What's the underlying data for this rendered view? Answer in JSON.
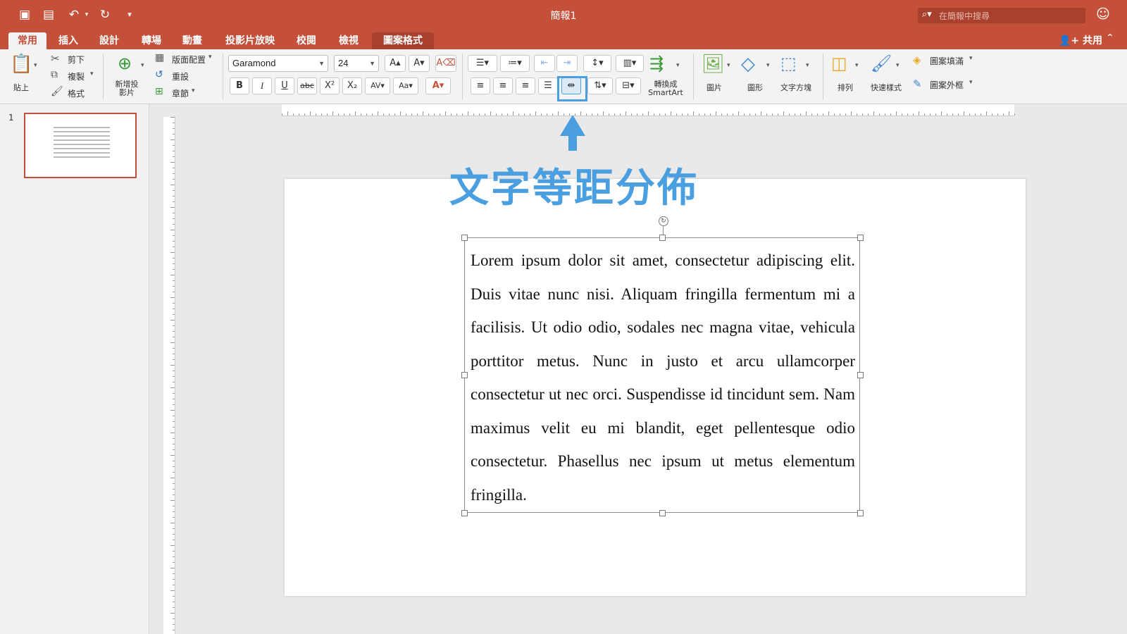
{
  "window": {
    "title": "簡報1",
    "search_placeholder": "在簡報中搜尋"
  },
  "tabs": [
    {
      "label": "常用",
      "active": true
    },
    {
      "label": "插入"
    },
    {
      "label": "設計"
    },
    {
      "label": "轉場"
    },
    {
      "label": "動畫"
    },
    {
      "label": "投影片放映"
    },
    {
      "label": "校閱"
    },
    {
      "label": "檢視"
    },
    {
      "label": "圖案格式",
      "contextual": true
    }
  ],
  "share_label": "共用",
  "ribbon": {
    "clipboard": {
      "paste": "貼上",
      "cut": "剪下",
      "copy": "複製",
      "format": "格式"
    },
    "slides": {
      "new_slide_line1": "新增投",
      "new_slide_line2": "影片",
      "layout": "版面配置",
      "reset": "重設",
      "section": "章節"
    },
    "font": {
      "name": "Garamond",
      "size": "24"
    },
    "convert_line1": "轉換成",
    "convert_line2": "SmartArt",
    "drawing": {
      "picture": "圖片",
      "shapes": "圖形",
      "textbox": "文字方塊",
      "arrange": "排列",
      "quick_styles": "快速樣式",
      "shape_fill": "圖案填滿",
      "shape_outline": "圖案外框"
    }
  },
  "slide_panel": {
    "slide_number": "1"
  },
  "slide": {
    "body_text": "Lorem ipsum dolor sit amet, consectetur adipiscing elit. Duis vitae nunc nisi. Aliquam fringilla fermentum mi a facilisis. Ut odio odio, sodales nec magna vitae, vehicula porttitor metus. Nunc in justo et arcu ullamcorper consectetur ut nec orci. Suspendisse id tincidunt sem. Nam maximus velit eu mi blandit, eget pellentesque odio consectetur. Phasellus nec ipsum ut metus elementum fringilla."
  },
  "annotation": "文字等距分佈",
  "colors": {
    "accent": "#c4503a",
    "annotation": "#4a9fe0"
  }
}
